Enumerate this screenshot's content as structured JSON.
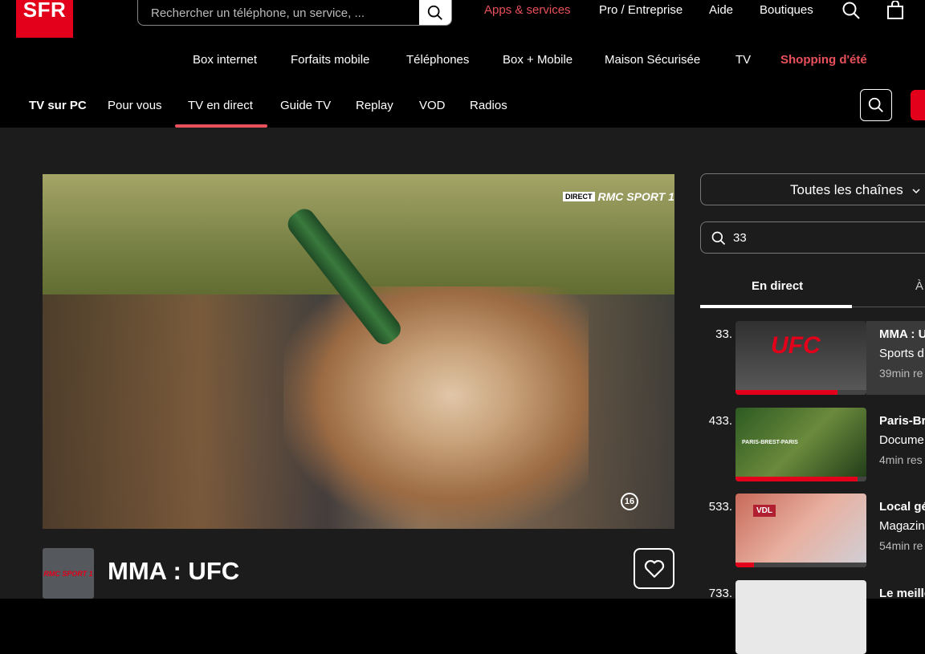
{
  "brand": {
    "logo_text": "SFR",
    "accent": "#e2001a",
    "highlight": "#e8505b"
  },
  "top_search": {
    "placeholder": "Rechercher un téléphone, un service, ..."
  },
  "top_links": [
    {
      "label": "Apps & services",
      "color": "#e8505b"
    },
    {
      "label": "Pro / Entreprise"
    },
    {
      "label": "Aide"
    },
    {
      "label": "Boutiques"
    }
  ],
  "main_nav": [
    "Box internet",
    "Forfaits mobile",
    "Téléphones",
    "Box + Mobile",
    "Maison Sécurisée",
    "TV",
    "Shopping d'été"
  ],
  "sub_nav": {
    "brand": "TV sur PC",
    "items": [
      "Pour vous",
      "TV en direct",
      "Guide TV",
      "Replay",
      "VOD",
      "Radios"
    ],
    "active_index": 1
  },
  "player": {
    "live_label": "DIRECT",
    "channel_tag": "RMC SPORT 1",
    "age_rating": "16"
  },
  "program": {
    "channel_logo": "RMC SPORT 1",
    "title": "MMA : UFC"
  },
  "channel_filter": {
    "selected": "Toutes les chaînes"
  },
  "channel_search": {
    "value": "33"
  },
  "tabs": {
    "live": "En direct",
    "next": "À"
  },
  "channels": [
    {
      "number": "33.",
      "title": "MMA : U",
      "genre": "Sports d",
      "remaining": "39min re",
      "progress": 0.78,
      "thumb_text": "UFC",
      "active": true
    },
    {
      "number": "433.",
      "title": "Paris-Br",
      "genre": "Docume",
      "remaining": "4min res",
      "progress": 0.93,
      "thumb_text": "PARIS-BREST-PARIS",
      "active": false
    },
    {
      "number": "533.",
      "title": "Local gé",
      "genre": "Magazin",
      "remaining": "54min re",
      "progress": 0.14,
      "thumb_text": "VDL",
      "active": false
    },
    {
      "number": "733.",
      "title": "Le meille",
      "genre": "",
      "remaining": "",
      "progress": 0.0,
      "thumb_text": "",
      "active": false
    }
  ]
}
